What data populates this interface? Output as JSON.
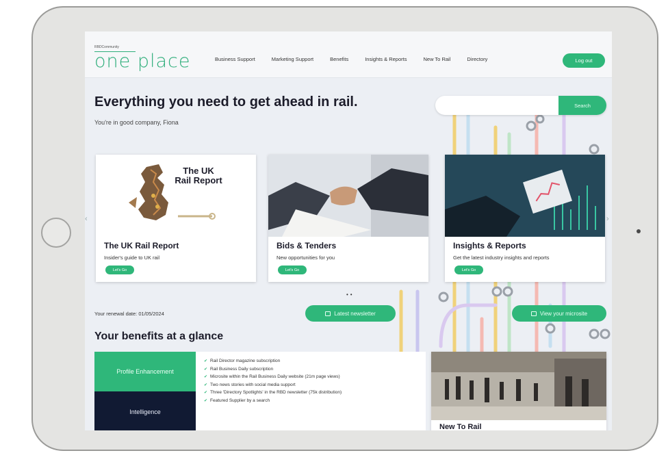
{
  "header": {
    "brand_small": "RBDCommunity",
    "brand": "one place",
    "nav": [
      "Business Support",
      "Marketing Support",
      "Benefits",
      "Insights & Reports",
      "New To Rail",
      "Directory"
    ],
    "logout_label": "Log out"
  },
  "hero": {
    "title": "Everything you need to get ahead in rail.",
    "subtitle": "You're in good company, Fiona"
  },
  "search": {
    "button_label": "Search",
    "placeholder": ""
  },
  "cards": [
    {
      "title": "The UK Rail Report",
      "desc": "Insider's guide to UK rail",
      "cta": "Let's Go",
      "image_heading": "The UK Rail Report"
    },
    {
      "title": "Bids & Tenders",
      "desc": "New opportunities for you",
      "cta": "Let's Go"
    },
    {
      "title": "Insights & Reports",
      "desc": "Get the latest industry insights and reports",
      "cta": "Let's Go"
    }
  ],
  "renewal_text": "Your renewal date: 01/05/2024",
  "buttons": {
    "newsletter": "Latest newsletter",
    "microsite": "View your microsite"
  },
  "benefits": {
    "heading": "Your benefits at a glance",
    "tabs": [
      "Profile Enhancement",
      "Intelligence"
    ],
    "items": [
      "Rail Director magazine subscription",
      "Rail Business Daily subscription",
      "Microsite within the Rail Business Daily website (21m page views)",
      "Two news stories with social media support",
      "Three 'Directory Spotlights' in the RBD newsletter (75k distribution)",
      "Featured Supplier by a search"
    ]
  },
  "new_to_rail": {
    "title": "New To Rail"
  },
  "colors": {
    "accent": "#2fb77a",
    "dark": "#111a33",
    "background": "#eceff4"
  }
}
